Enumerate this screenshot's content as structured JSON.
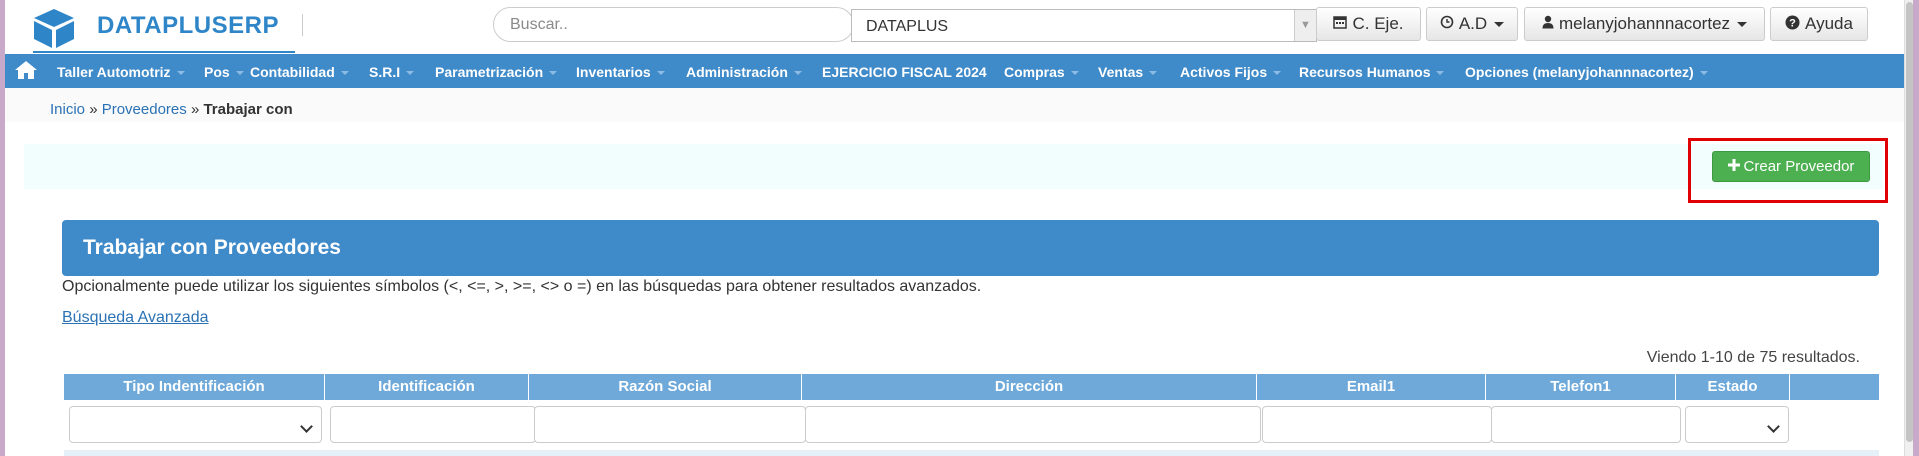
{
  "app": {
    "brand": "DATAPLUSERP"
  },
  "header": {
    "search_placeholder": "Buscar..",
    "company_value": "DATAPLUS",
    "buttons": {
      "c_eje": "C. Eje.",
      "ad": "A.D",
      "user": "melanyjohannnacortez",
      "help": "Ayuda"
    }
  },
  "nav": {
    "items": [
      "Taller Automotriz",
      "Pos",
      "Contabilidad",
      "S.R.I",
      "Parametrización",
      "Inventarios",
      "Administración",
      "EJERCICIO FISCAL 2024",
      "Compras",
      "Ventas",
      "Activos Fijos",
      "Recursos Humanos",
      "Opciones (melanyjohannnacortez)"
    ]
  },
  "breadcrumb": {
    "home": "Inicio",
    "section": "Proveedores",
    "current": "Trabajar con",
    "sep": "»"
  },
  "actions": {
    "create_label": "Crear Proveedor"
  },
  "panel": {
    "title": "Trabajar con Proveedores",
    "hint": "Opcionalmente puede utilizar los siguientes símbolos (<, <=, >, >=, <> o =) en las búsquedas para obtener resultados avanzados.",
    "advanced_search": "Búsqueda Avanzada",
    "summary": "Viendo 1-10 de 75 resultados."
  },
  "table": {
    "columns": [
      "Tipo Indentificación",
      "Identificación",
      "Razón Social",
      "Dirección",
      "Email1",
      "Telefon1",
      "Estado"
    ]
  },
  "colors": {
    "primary": "#3f8ac9",
    "success": "#4caf50",
    "highlight": "#e00000"
  },
  "icons": {
    "logo": "cube-logo-icon",
    "home": "home-icon",
    "calendar": "calendar-icon",
    "clock": "clock-icon",
    "user": "user-icon",
    "help": "question-circle-icon",
    "plus": "plus-icon"
  }
}
